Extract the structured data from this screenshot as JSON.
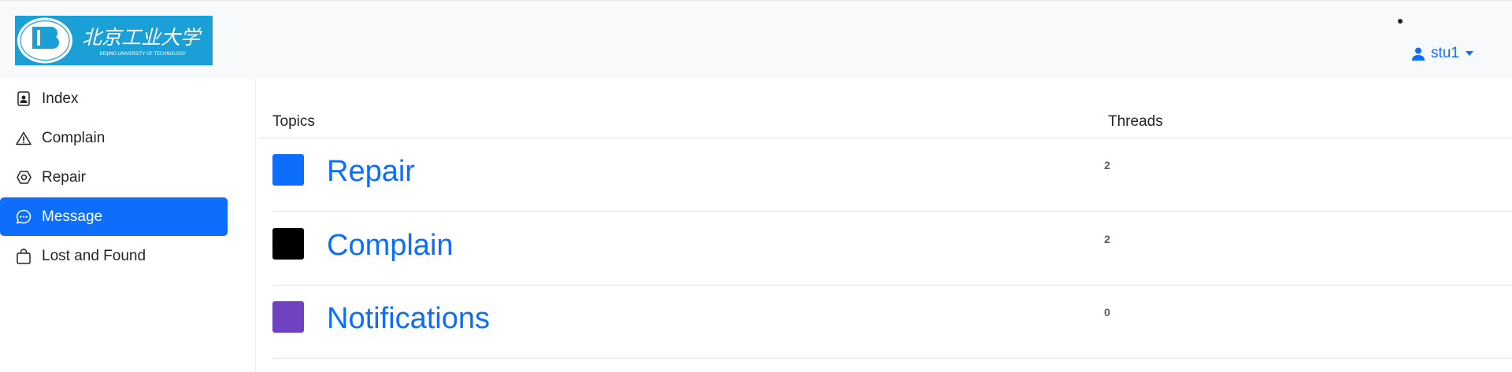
{
  "header": {
    "logo_alt": "BEIJING UNIVERSITY OF TECHNOLOGY",
    "logo_chinese": "北京工业大学",
    "user": {
      "name": "stu1",
      "icon": "person-icon"
    }
  },
  "sidebar": {
    "items": [
      {
        "label": "Index",
        "icon": "document-person-icon",
        "active": false
      },
      {
        "label": "Complain",
        "icon": "warning-triangle-icon",
        "active": false
      },
      {
        "label": "Repair",
        "icon": "nut-icon",
        "active": false
      },
      {
        "label": "Message",
        "icon": "chat-dots-icon",
        "active": true
      },
      {
        "label": "Lost and Found",
        "icon": "bag-icon",
        "active": false
      }
    ]
  },
  "table": {
    "headers": {
      "topics": "Topics",
      "threads": "Threads"
    },
    "rows": [
      {
        "topic": "Repair",
        "threads": "2",
        "color": "#0d6efd"
      },
      {
        "topic": "Complain",
        "threads": "2",
        "color": "#000000"
      },
      {
        "topic": "Notifications",
        "threads": "0",
        "color": "#6f42c1"
      }
    ]
  },
  "colors": {
    "accent": "#0d6efd",
    "navbar_bg": "#f8f9fa",
    "logo_bg": "#1a9fd6"
  }
}
